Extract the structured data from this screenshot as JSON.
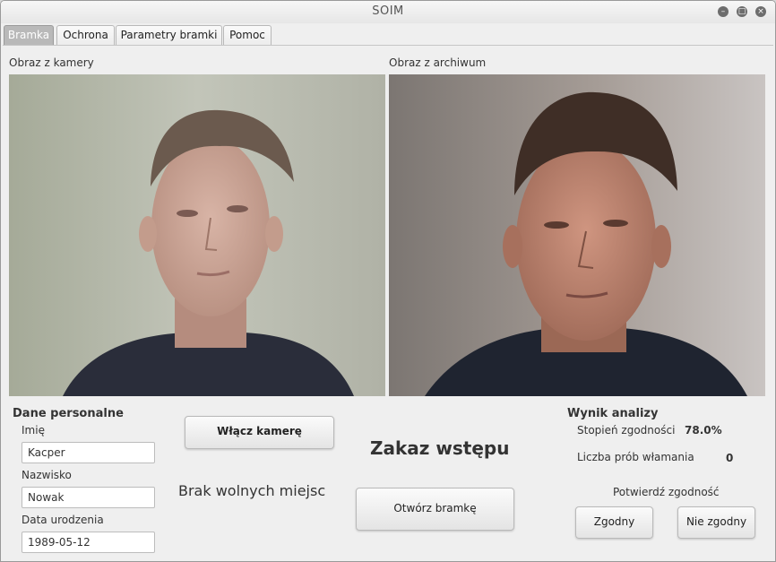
{
  "window": {
    "title": "SOIM"
  },
  "tabs": [
    {
      "label": "Bramka"
    },
    {
      "label": "Ochrona"
    },
    {
      "label": "Parametry bramki"
    },
    {
      "label": "Pomoc"
    }
  ],
  "camera": {
    "label": "Obraz z kamery"
  },
  "archive": {
    "label": "Obraz z archiwum"
  },
  "personal": {
    "heading": "Dane personalne",
    "first_name_label": "Imię",
    "first_name_value": "Kacper",
    "last_name_label": "Nazwisko",
    "last_name_value": "Nowak",
    "birthdate_label": "Data urodzenia",
    "birthdate_value": "1989-05-12"
  },
  "controls": {
    "camera_button": "Włącz kamerę",
    "status_message": "Zakaz wstępu",
    "info_message": "Brak wolnych miejsc",
    "open_gate_button": "Otwórz bramkę"
  },
  "analysis": {
    "heading": "Wynik analizy",
    "match_label": "Stopień zgodności",
    "match_value": "78.0%",
    "attempts_label": "Liczba prób włamania",
    "attempts_value": "0",
    "confirm_label": "Potwierdź zgodność",
    "match_button": "Zgodny",
    "nomatch_button": "Nie zgodny"
  },
  "colors": {
    "active_tab": "#b9b9b9",
    "window_bg": "#efefef"
  }
}
